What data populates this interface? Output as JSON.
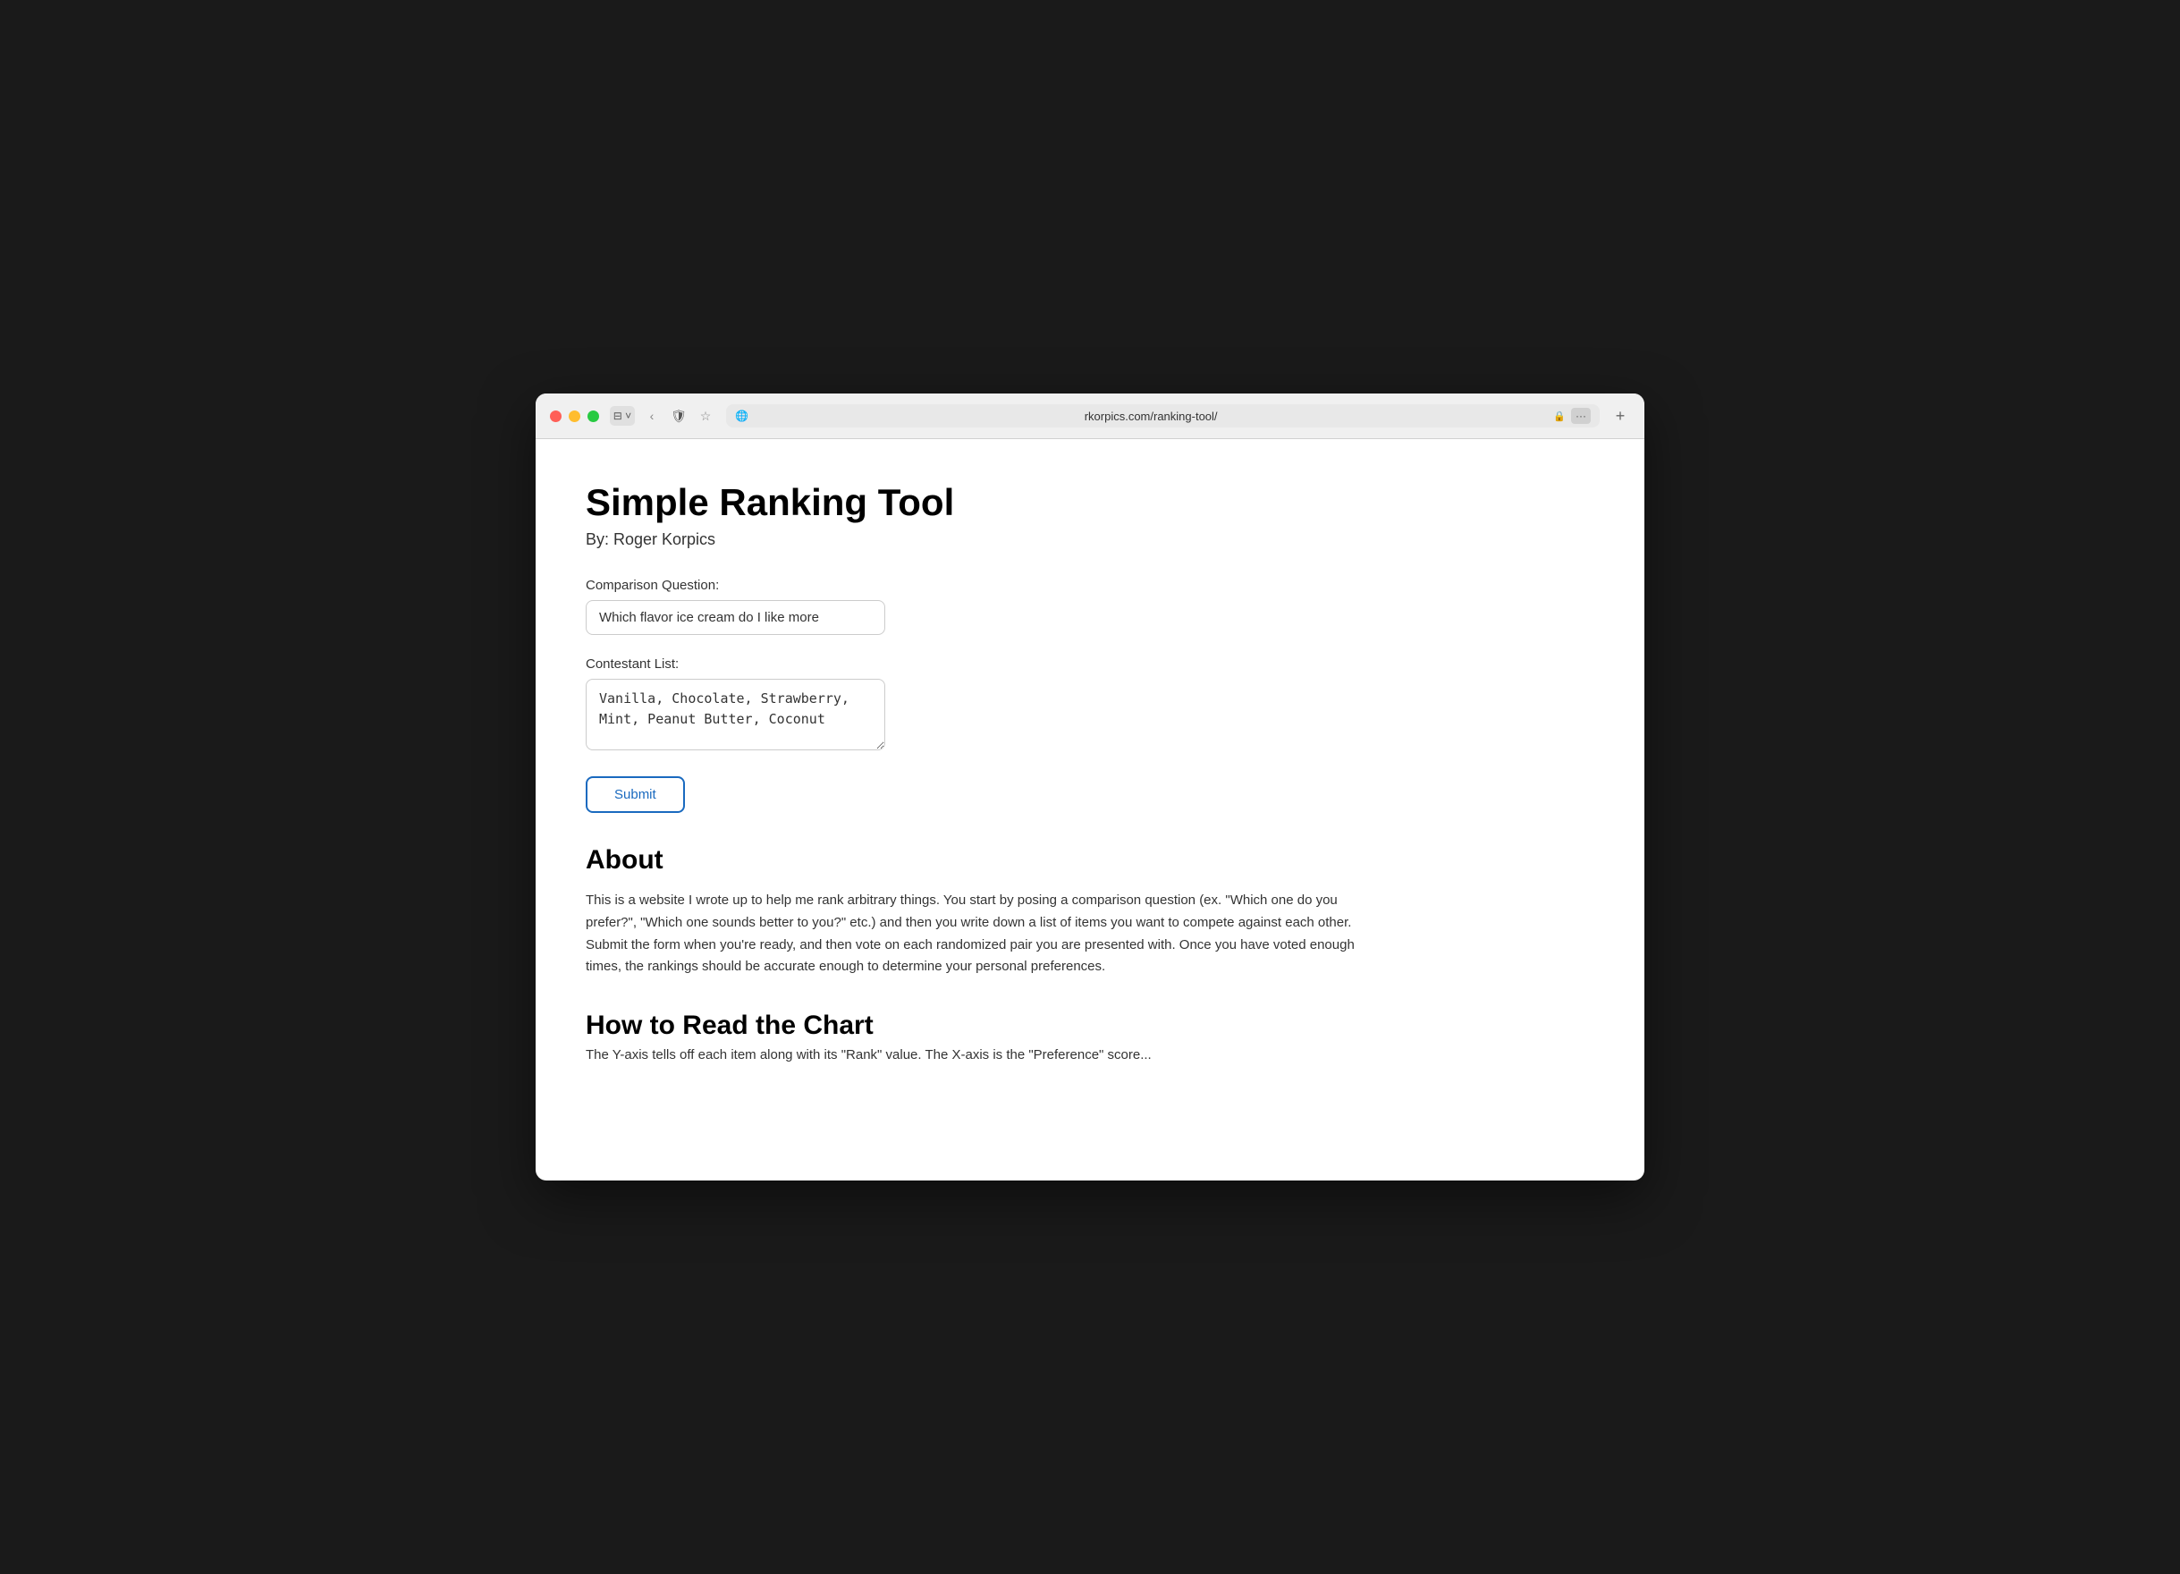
{
  "browser": {
    "url": "rkorpics.com/ranking-tool/",
    "lock_symbol": "🔒",
    "globe_symbol": "🌐",
    "menu_symbol": "···"
  },
  "page": {
    "title": "Simple Ranking Tool",
    "author": "By: Roger Korpics",
    "form": {
      "question_label": "Comparison Question:",
      "question_value": "Which flavor ice cream do I like more",
      "contestants_label": "Contestant List:",
      "contestants_value": "Vanilla, Chocolate, Strawberry, Mint, Peanut Butter, Coconut",
      "submit_label": "Submit"
    },
    "about": {
      "title": "About",
      "text": "This is a website I wrote up to help me rank arbitrary things. You start by posing a comparison question (ex. \"Which one do you prefer?\", \"Which one sounds better to you?\" etc.) and then you write down a list of items you want to compete against each other. Submit the form when you're ready, and then vote on each randomized pair you are presented with. Once you have voted enough times, the rankings should be accurate enough to determine your personal preferences."
    },
    "how_to": {
      "title": "How to Read the Chart",
      "partial_text": "The Y-axis tells off each item along with its \"Rank\" value. The X-axis is the \"Preference\" score..."
    }
  }
}
